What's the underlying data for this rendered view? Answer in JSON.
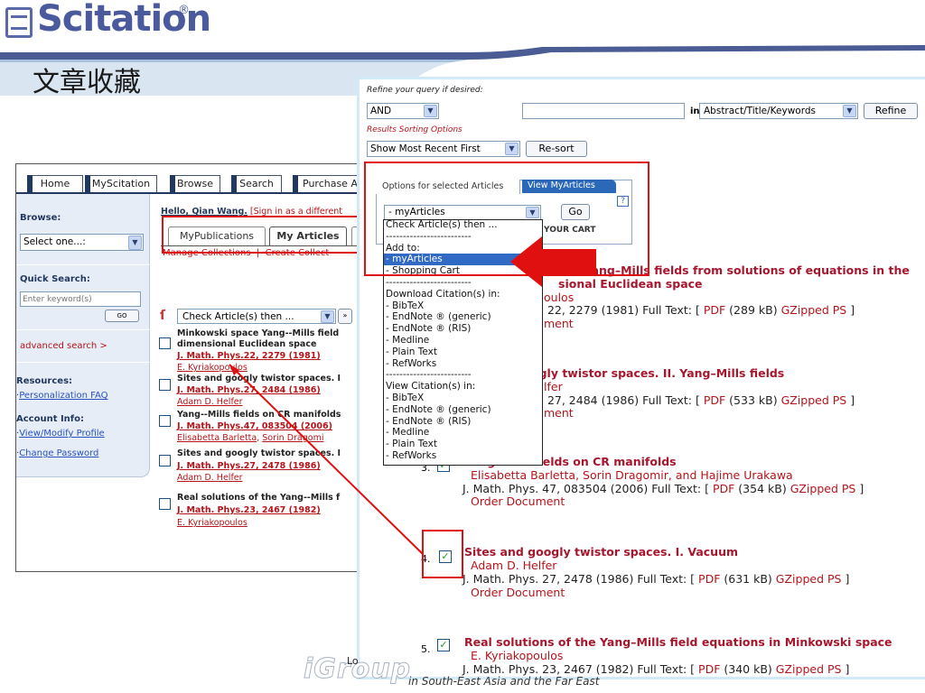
{
  "slide": {
    "logo": "Scitation",
    "logo_reg": "®",
    "title": "文章收藏",
    "footer_brand": "iGroup",
    "footer_fragment": "Lo",
    "footer_text": "in South-East Asia and the Far East"
  },
  "left": {
    "nav": [
      "Home",
      "MyScitation",
      "Browse",
      "Search",
      "Purchase A"
    ],
    "browse_label": "Browse:",
    "browse_select": "Select one...:",
    "quick_search_label": "Quick Search:",
    "search_placeholder": "Enter keyword(s)",
    "go": "GO",
    "advanced_search": "advanced search >",
    "resources_label": "Resources:",
    "resources": [
      "Personalization FAQ"
    ],
    "account_label": "Account Info:",
    "account": [
      "View/Modify Profile",
      "Change Password"
    ],
    "greeting": "Hello, Qian Wang.",
    "signin": "[Sign in as a different",
    "tabs": [
      "MyPublications",
      "My Articles"
    ],
    "manage": "Manage Collections  |  Create Collect",
    "action_select": "Check Article(s) then ...",
    "items": [
      {
        "title": "Minkowski space Yang--Mills field",
        "title2": "dimensional Euclidean space",
        "ref": "J. Math. Phys.22, 2279 (1981)",
        "authors": [
          "E. Kyriakopoulos"
        ]
      },
      {
        "title": "Sites and googly twistor spaces. I",
        "title2": "",
        "ref": "J. Math. Phys.27, 2484 (1986)",
        "authors": [
          "Adam D. Helfer"
        ]
      },
      {
        "title": "Yang--Mills fields on CR manifolds",
        "title2": "",
        "ref": "J. Math. Phys.47, 083504 (2006)",
        "authors": [
          "Elisabetta Barletta",
          "Sorin Dragomi"
        ]
      },
      {
        "title": "Sites and googly twistor spaces. I",
        "title2": "",
        "ref": "J. Math. Phys.27, 2478 (1986)",
        "authors": [
          "Adam D. Helfer"
        ]
      },
      {
        "title": "Real solutions of the Yang--Mills f",
        "title2": "",
        "ref": "J. Math. Phys.23, 2467 (1982)",
        "authors": [
          "E. Kyriakopoulos"
        ]
      }
    ]
  },
  "right": {
    "refine_label": "Refine your query if desired:",
    "bool_select": "AND",
    "in_label": "in",
    "field_select": "Abstract/Title/Keywords",
    "refine_button": "Refine",
    "sort_label": "Results Sorting Options",
    "sort_select": "Show Most Recent First",
    "resort_button": "Re-sort",
    "options_tab": "Options for selected Articles",
    "view_tab": "View MyArticles",
    "help": "?",
    "action_select": "- myArticles",
    "go_button": "Go",
    "cart_text": "YOUR CART",
    "dropdown": [
      "Check Article(s) then ...",
      "-------------------------",
      "Add to:",
      "- myArticles",
      "- Shopping Cart",
      "-------------------------",
      "Download Citation(s) in:",
      "- BibTeX",
      "- EndNote ® (generic)",
      "- EndNote ® (RIS)",
      "- Medline",
      "- Plain Text",
      "- RefWorks",
      "-------------------------",
      "View Citation(s) in:",
      "- BibTeX",
      "- EndNote ® (generic)",
      "- EndNote ® (RIS)",
      "- Medline",
      "- Plain Text",
      "- RefWorks"
    ],
    "dropdown_selected": 3,
    "full_text": "Full Text: [",
    "pdf": "PDF",
    "gzipped": "GZipped PS",
    "close_bracket": "]",
    "order": "Order Document",
    "articles": [
      {
        "num": "",
        "checked": false,
        "title": "ace Yang–Mills fields from solutions of equations in the",
        "title2": "sional Euclidean space",
        "authors": "oulos",
        "journal": ". 22, 2279 (1981)",
        "size": "(289 kB)",
        "order": "ment"
      },
      {
        "num": "",
        "checked": false,
        "title": "ogly twistor spaces. II. Yang–Mills fields",
        "title2": "",
        "authors": "lfer",
        "journal": ". 27, 2484 (1986)",
        "size": "(533 kB)",
        "order": "ment"
      },
      {
        "num": "3.",
        "checked": true,
        "title": "Yang–Mills fields on CR manifolds",
        "title2": "",
        "authors": "Elisabetta Barletta, Sorin Dragomir, and Hajime Urakawa",
        "journal": "J. Math. Phys. 47, 083504 (2006)",
        "size": "(354 kB)",
        "order": "Order Document"
      },
      {
        "num": "4.",
        "checked": true,
        "title": "Sites and googly twistor spaces. I. Vacuum",
        "title2": "",
        "authors": "Adam D. Helfer",
        "journal": "J. Math. Phys. 27, 2478 (1986)",
        "size": "(631 kB)",
        "order": "Order Document"
      },
      {
        "num": "5.",
        "checked": true,
        "title": "Real solutions of the Yang–Mills field equations in Minkowski space",
        "title2": "",
        "authors": "E. Kyriakopoulos",
        "journal": "J. Math. Phys. 23, 2467 (1982)",
        "size": "(340 kB)",
        "order": ""
      }
    ]
  },
  "colors": {
    "accent": "#2e3f8f",
    "link_red": "#b5141a",
    "highlight": "#e01010",
    "pane_border": "#d2eaf7"
  }
}
